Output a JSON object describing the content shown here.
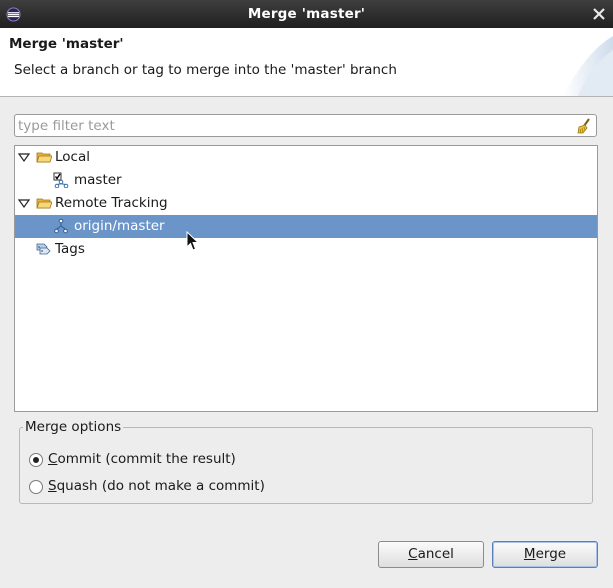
{
  "window": {
    "title": "Merge 'master'"
  },
  "header": {
    "title": "Merge 'master'",
    "description": "Select a branch or tag to merge into the 'master' branch"
  },
  "filter": {
    "placeholder": "type filter text",
    "value": ""
  },
  "tree": {
    "items": [
      {
        "label": "Local",
        "icon": "folder-open-icon",
        "expanded": true
      },
      {
        "label": "master",
        "icon": "checked-out-branch-icon"
      },
      {
        "label": "Remote Tracking",
        "icon": "folder-open-icon",
        "expanded": true
      },
      {
        "label": "origin/master",
        "icon": "branch-icon",
        "selected": true
      },
      {
        "label": "Tags",
        "icon": "tags-icon"
      }
    ]
  },
  "merge_options": {
    "legend": "Merge options",
    "commit": {
      "mnemonic": "C",
      "label": "ommit (commit the result)",
      "checked": true
    },
    "squash": {
      "mnemonic": "S",
      "label": "quash (do not make a commit)",
      "checked": false
    }
  },
  "buttons": {
    "cancel": {
      "mnemonic": "C",
      "label": "ancel"
    },
    "merge": {
      "mnemonic": "M",
      "label": "erge"
    }
  },
  "colors": {
    "selection": "#6b94c8",
    "titlebar": "#2b2b2b"
  }
}
